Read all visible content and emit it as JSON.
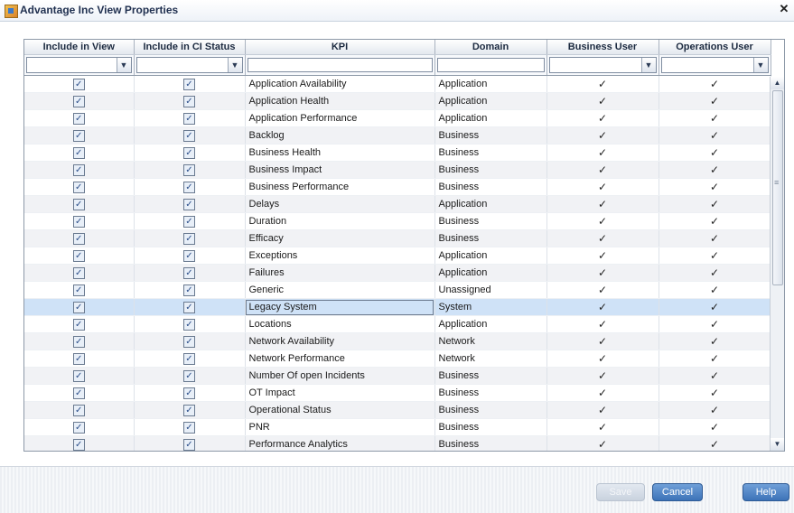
{
  "window": {
    "title": "Advantage Inc View Properties",
    "close_label": "✕"
  },
  "columns": [
    {
      "label": "Include in View",
      "filter": "combo"
    },
    {
      "label": "Include in CI Status",
      "filter": "combo"
    },
    {
      "label": "KPI",
      "filter": "text"
    },
    {
      "label": "Domain",
      "filter": "text"
    },
    {
      "label": "Business User",
      "filter": "combo"
    },
    {
      "label": "Operations User",
      "filter": "combo"
    }
  ],
  "rows": [
    {
      "kpi": "Application Availability",
      "domain": "Application"
    },
    {
      "kpi": "Application Health",
      "domain": "Application"
    },
    {
      "kpi": "Application Performance",
      "domain": "Application"
    },
    {
      "kpi": "Backlog",
      "domain": "Business"
    },
    {
      "kpi": "Business Health",
      "domain": "Business"
    },
    {
      "kpi": "Business Impact",
      "domain": "Business"
    },
    {
      "kpi": "Business Performance",
      "domain": "Business"
    },
    {
      "kpi": "Delays",
      "domain": "Application"
    },
    {
      "kpi": "Duration",
      "domain": "Business"
    },
    {
      "kpi": "Efficacy",
      "domain": "Business"
    },
    {
      "kpi": "Exceptions",
      "domain": "Application"
    },
    {
      "kpi": "Failures",
      "domain": "Application"
    },
    {
      "kpi": "Generic",
      "domain": "Unassigned"
    },
    {
      "kpi": "Legacy System",
      "domain": "System",
      "selected": true
    },
    {
      "kpi": "Locations",
      "domain": "Application"
    },
    {
      "kpi": "Network Availability",
      "domain": "Network"
    },
    {
      "kpi": "Network Performance",
      "domain": "Network"
    },
    {
      "kpi": "Number Of open Incidents",
      "domain": "Business"
    },
    {
      "kpi": "OT Impact",
      "domain": "Business"
    },
    {
      "kpi": "Operational Status",
      "domain": "Business"
    },
    {
      "kpi": "PNR",
      "domain": "Business"
    },
    {
      "kpi": "Performance Analytics",
      "domain": "Business"
    }
  ],
  "glyphs": {
    "checkbox": "✓",
    "tick": "✓",
    "dropdown": "▼",
    "scroll_up": "▲",
    "scroll_down": "▼"
  },
  "buttons": {
    "save": "Save",
    "cancel": "Cancel",
    "help": "Help"
  },
  "colors": {
    "accent": "#3d73b8",
    "selected_row": "#cfe2f7"
  }
}
